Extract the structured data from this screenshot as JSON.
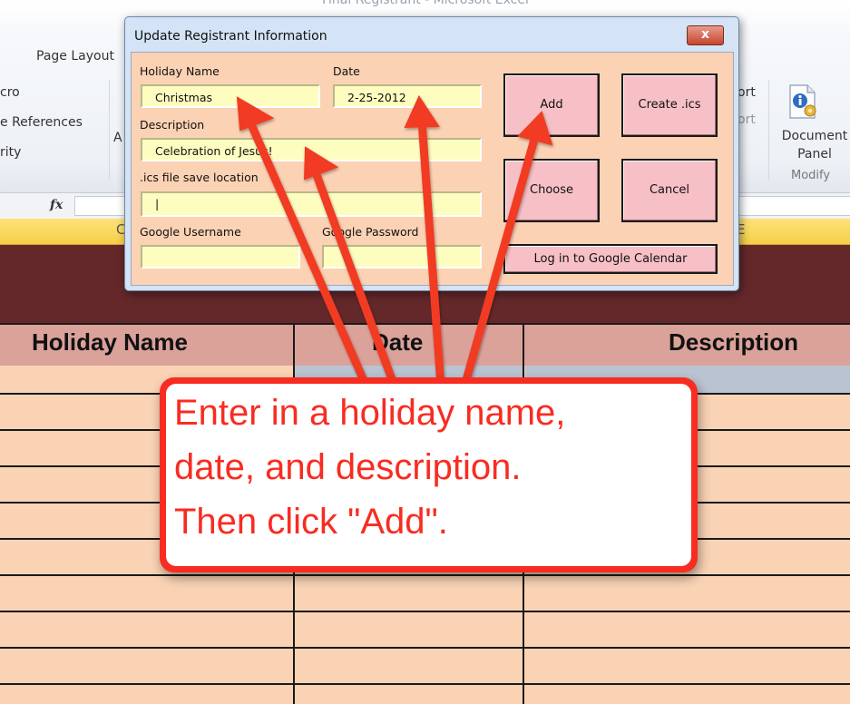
{
  "ribbon": {
    "window_title": "Final Registrant - Microsoft Excel",
    "tab_page_layout": "Page Layout",
    "left_items": [
      "cro",
      "e References",
      "rity"
    ],
    "partial_letter": "A",
    "right_items": [
      "ort",
      "ort"
    ],
    "document_panel": "Document\nPanel",
    "modify_label": "Modify"
  },
  "formula_bar": {
    "fx_label": "fx"
  },
  "column_strip": {
    "left_text": "C",
    "right_text": "E"
  },
  "table": {
    "headers": [
      "Holiday Name",
      "Date",
      "Description"
    ]
  },
  "dialog": {
    "title": "Update Registrant Information",
    "close_label": "x",
    "holiday_name_label": "Holiday Name",
    "holiday_name_value": "Christmas",
    "date_label": "Date",
    "date_value": "2-25-2012",
    "description_label": "Description",
    "description_value": "Celebration of Jesus!",
    "ics_location_label": ".ics file save location",
    "ics_location_value": "|",
    "google_username_label": "Google Username",
    "google_username_value": "",
    "google_password_label": "Google Password",
    "google_password_value": "",
    "add_button": "Add",
    "create_ics_button": "Create .ics",
    "choose_button": "Choose",
    "cancel_button": "Cancel",
    "google_login_button": "Log in to Google Calendar"
  },
  "callout": {
    "lines": [
      "Enter in a holiday name,",
      "date, and description.",
      "Then click \"Add\"."
    ]
  },
  "colors": {
    "callout_red": "#f82c21",
    "dialog_body": "#fcd2b4",
    "field_yellow": "#fdfdc0",
    "button_pink": "#f7c0c6",
    "table_header": "#dba29a",
    "table_body": "#fad3b5",
    "maroon": "#64282a"
  },
  "icons": {
    "document_panel": "info-gear-icon",
    "formula": "fx-icon",
    "close": "close-icon"
  }
}
